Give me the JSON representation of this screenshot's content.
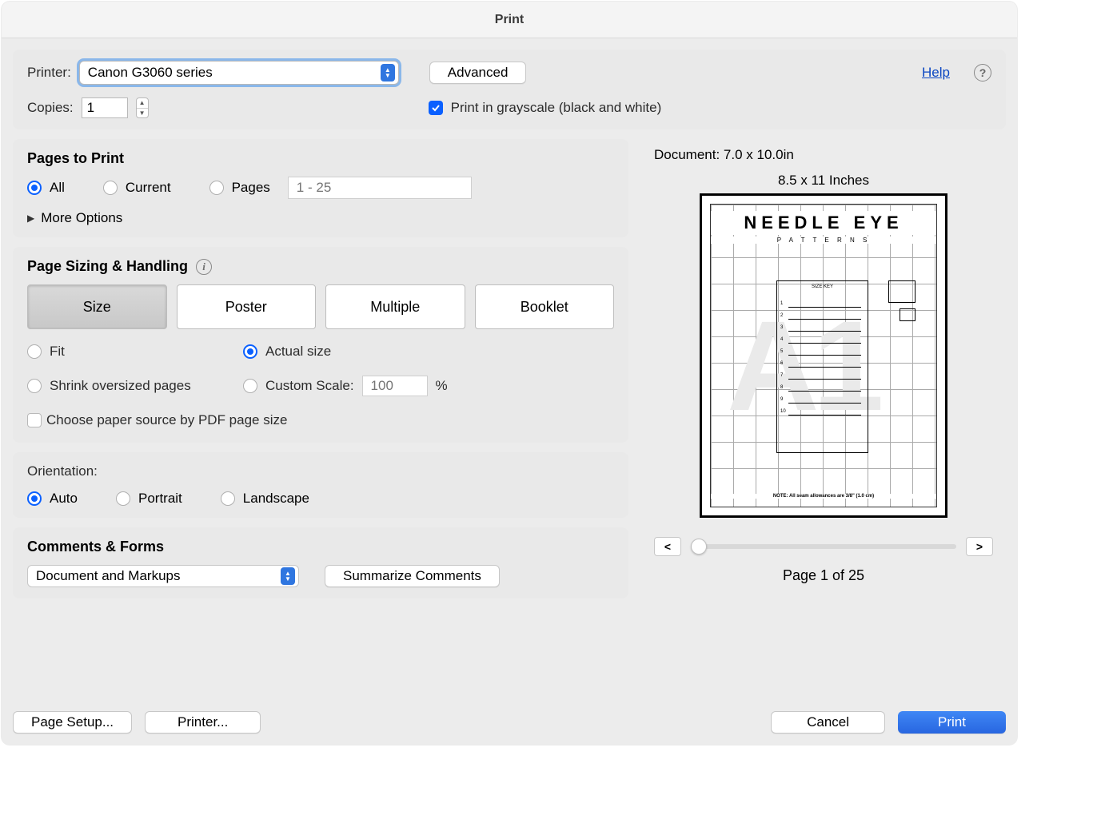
{
  "title": "Print",
  "top": {
    "printer_label": "Printer:",
    "printer_value": "Canon G3060 series",
    "advanced": "Advanced",
    "help": "Help",
    "copies_label": "Copies:",
    "copies_value": "1",
    "grayscale_label": "Print in grayscale (black and white)",
    "grayscale_checked": true
  },
  "pages": {
    "title": "Pages to Print",
    "all": "All",
    "current": "Current",
    "pages": "Pages",
    "range_placeholder": "1 - 25",
    "more_options": "More Options",
    "selected": "all"
  },
  "sizing": {
    "title": "Page Sizing & Handling",
    "tabs": {
      "size": "Size",
      "poster": "Poster",
      "multiple": "Multiple",
      "booklet": "Booklet"
    },
    "active_tab": "size",
    "fit": "Fit",
    "actual": "Actual size",
    "shrink": "Shrink oversized pages",
    "custom": "Custom Scale:",
    "scale_value": "100",
    "percent": "%",
    "selected": "actual",
    "paper_source": "Choose paper source by PDF page size",
    "paper_source_checked": false
  },
  "orientation": {
    "title": "Orientation:",
    "auto": "Auto",
    "portrait": "Portrait",
    "landscape": "Landscape",
    "selected": "auto"
  },
  "comments": {
    "title": "Comments & Forms",
    "select_value": "Document and Markups",
    "summarize": "Summarize Comments"
  },
  "preview": {
    "document_dims": "Document: 7.0 x 10.0in",
    "paper_dims": "8.5 x 11 Inches",
    "doc_title": "NEEDLE EYE",
    "doc_sub": "P A T T E R N S",
    "prev": "<",
    "next": ">",
    "page_indicator": "Page 1 of 25"
  },
  "footer": {
    "page_setup": "Page Setup...",
    "printer_btn": "Printer...",
    "cancel": "Cancel",
    "print": "Print"
  }
}
